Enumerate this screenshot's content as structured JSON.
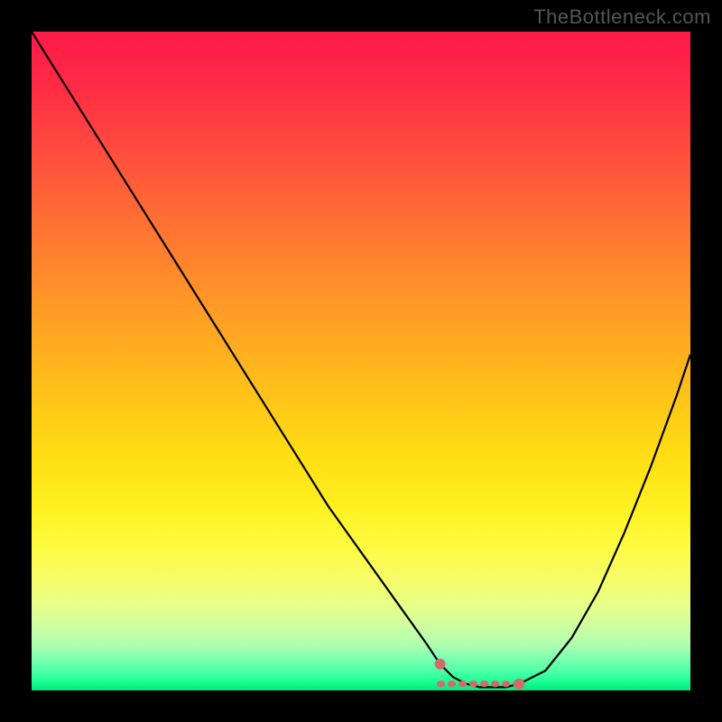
{
  "watermark": "TheBottleneck.com",
  "chart_data": {
    "type": "line",
    "title": "",
    "xlabel": "",
    "ylabel": "",
    "xlim": [
      0,
      100
    ],
    "ylim": [
      0,
      100
    ],
    "x": [
      0,
      5,
      10,
      15,
      20,
      25,
      30,
      35,
      40,
      45,
      50,
      55,
      60,
      62,
      64,
      66,
      68,
      70,
      72,
      74,
      78,
      82,
      86,
      90,
      94,
      98,
      100
    ],
    "y": [
      100,
      92,
      84,
      76,
      68,
      60,
      52,
      44,
      36,
      28,
      21,
      14,
      7,
      4,
      2,
      1,
      0.5,
      0.5,
      0.5,
      1,
      3,
      8,
      15,
      24,
      34,
      45,
      51
    ],
    "optimal_range_x": [
      62,
      74
    ],
    "annotations": [],
    "background_gradient": {
      "top_color": "#ff1a4a",
      "bottom_color": "#00e878",
      "description": "vertical red-to-yellow-to-green gradient indicating bottleneck severity"
    }
  }
}
